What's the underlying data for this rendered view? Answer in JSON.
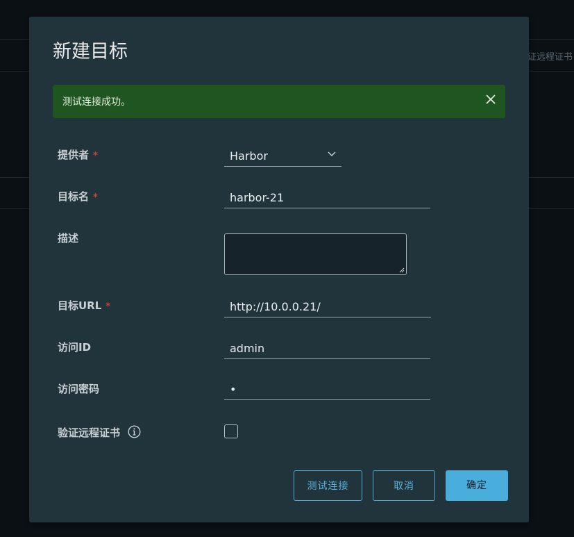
{
  "background": {
    "peek_text": "证远程证书"
  },
  "dialog": {
    "title": "新建目标",
    "alert": {
      "message": "测试连接成功。",
      "close_icon": "close-icon"
    },
    "fields": {
      "provider": {
        "label": "提供者",
        "required_mark": "*",
        "value": "Harbor"
      },
      "name": {
        "label": "目标名",
        "required_mark": "*",
        "value": "harbor-21"
      },
      "description": {
        "label": "描述",
        "value": ""
      },
      "url": {
        "label": "目标URL",
        "required_mark": "*",
        "value": "http://10.0.0.21/"
      },
      "access_id": {
        "label": "访问ID",
        "value": "admin"
      },
      "access_secret": {
        "label": "访问密码",
        "value": "•"
      },
      "verify_cert": {
        "label": "验证远程证书",
        "info_icon": "info-icon",
        "checked": false
      }
    },
    "buttons": {
      "test": "测试连接",
      "cancel": "取消",
      "ok": "确定"
    }
  },
  "colors": {
    "modal_bg": "#21333b",
    "alert_bg": "#1f5521",
    "accent": "#49aedc",
    "required": "#d0403a"
  }
}
